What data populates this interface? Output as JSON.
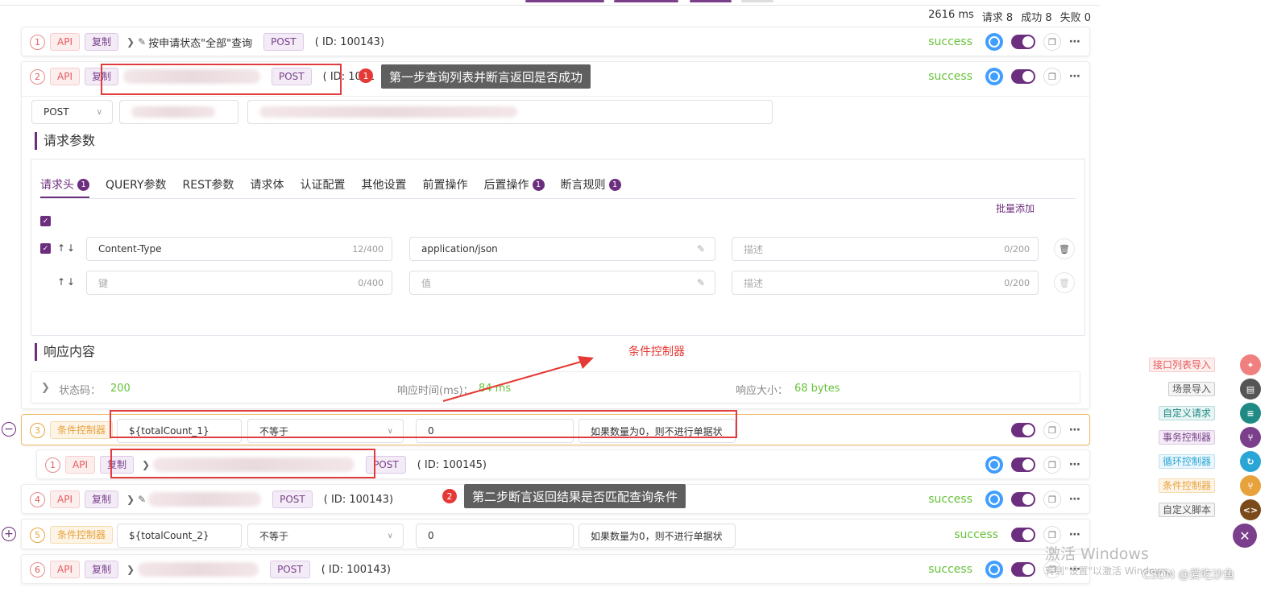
{
  "stats": {
    "time": "2616 ms",
    "requests": "请求 8",
    "success": "成功 8",
    "fail": "失败 0"
  },
  "tags": {
    "api": "API",
    "copy": "复制",
    "post": "POST",
    "cond": "条件控制器"
  },
  "rows": [
    {
      "num": "1",
      "title": "按申请状态\"全部\"查询",
      "id": "( ID: 100143)",
      "status": "success"
    },
    {
      "num": "2",
      "title": "",
      "id": "( ID: 1001",
      "status": "success"
    },
    {
      "num": "3",
      "var": "${totalCount_1}",
      "op": "不等于",
      "value": "0",
      "desc": "如果数量为0，则不进行单据状"
    },
    {
      "num": "1",
      "title": "",
      "id": "( ID: 100145)"
    },
    {
      "num": "4",
      "title": "",
      "id": "( ID: 100143)",
      "status": "success"
    },
    {
      "num": "5",
      "var": "${totalCount_2}",
      "op": "不等于",
      "value": "0",
      "desc": "如果数量为0，则不进行单据状",
      "status": "success"
    },
    {
      "num": "6",
      "title": "",
      "id": "( ID: 100143)",
      "status": "success"
    }
  ],
  "detail": {
    "method": "POST",
    "section_params": "请求参数",
    "section_response": "响应内容",
    "tabs": [
      {
        "label": "请求头",
        "badge": "1"
      },
      {
        "label": "QUERY参数"
      },
      {
        "label": "REST参数"
      },
      {
        "label": "请求体"
      },
      {
        "label": "认证配置"
      },
      {
        "label": "其他设置"
      },
      {
        "label": "前置操作"
      },
      {
        "label": "后置操作",
        "badge": "1"
      },
      {
        "label": "断言规则",
        "badge": "1"
      }
    ],
    "batch_add": "批量添加",
    "header_rows": [
      {
        "key": "Content-Type",
        "key_count": "12/400",
        "value": "application/json",
        "desc_ph": "描述",
        "desc_count": "0/200"
      },
      {
        "key_ph": "键",
        "key_count": "0/400",
        "value_ph": "值",
        "desc_ph": "描述",
        "desc_count": "0/200"
      }
    ],
    "response": {
      "status_label": "状态码：",
      "status": "200",
      "time_label": "响应时间(ms)：",
      "time": "84 ms",
      "size_label": "响应大小：",
      "size": "68 bytes"
    }
  },
  "annotations": {
    "tip1": "第一步查询列表并断言返回是否成功",
    "tip2": "第二步断言返回结果是否匹配查询条件",
    "cond_label": "条件控制器",
    "dot1": "1",
    "dot2": "2"
  },
  "sidebar": [
    {
      "label": "接口列表导入",
      "color": "#e55b5b"
    },
    {
      "label": "场景导入",
      "color": "#555555"
    },
    {
      "label": "自定义请求",
      "color": "#1f8a84"
    },
    {
      "label": "事务控制器",
      "color": "#7b3f8c"
    },
    {
      "label": "循环控制器",
      "color": "#2aa6d6"
    },
    {
      "label": "条件控制器",
      "color": "#e8a23c"
    },
    {
      "label": "自定义脚本",
      "color": "#7a4a1a"
    }
  ],
  "watermark": {
    "title": "激活 Windows",
    "sub": "转到\"设置\"以激活 Windows。",
    "csdn": "CSDN @爱吃沙鱼"
  },
  "icons": {
    "close": "close-icon",
    "collapse": "minus-circle-icon",
    "expand": "plus-circle-icon"
  }
}
